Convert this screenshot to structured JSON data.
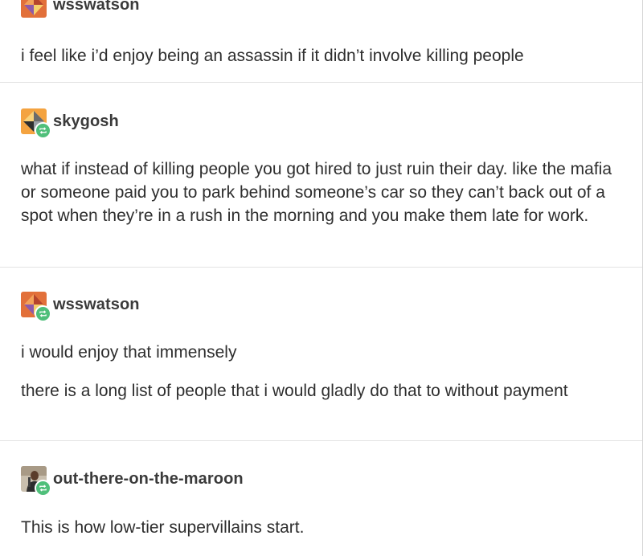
{
  "posts": [
    {
      "username": "wsswatson",
      "avatar_icon": "geometric-avatar-icon",
      "paragraphs": [
        "i feel like i’d enjoy being an assassin if it didn’t involve killing people"
      ]
    },
    {
      "username": "skygosh",
      "avatar_icon": "geometric-avatar-icon",
      "reblog_icon": "reblog-icon",
      "paragraphs": [
        "what if instead of killing people you got hired to just ruin their day. like the mafia or someone paid you to park behind someone’s car so they can’t back out of a spot when they’re in a rush in the morning and you make them late for work."
      ]
    },
    {
      "username": "wsswatson",
      "avatar_icon": "geometric-avatar-icon",
      "reblog_icon": "reblog-icon",
      "paragraphs": [
        "i would enjoy that immensely",
        "there is a long list of people that i would gladly do that to without payment"
      ]
    },
    {
      "username": "out-there-on-the-maroon",
      "avatar_icon": "person-photo-avatar-icon",
      "reblog_icon": "reblog-icon",
      "paragraphs": [
        "This is how low-tier supervillains start."
      ]
    }
  ],
  "colors": {
    "reblog_badge": "#4fbf7a",
    "avatar_orange": "#e2703a",
    "divider": "#e3e3e3"
  }
}
